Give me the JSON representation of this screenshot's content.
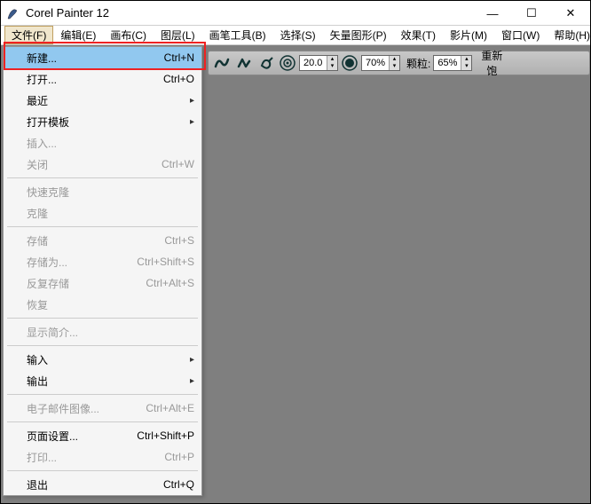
{
  "title": "Corel Painter 12",
  "window_controls": {
    "min": "—",
    "max": "☐",
    "close": "✕"
  },
  "menubar": [
    {
      "label": "文件(F)",
      "active": true
    },
    {
      "label": "编辑(E)"
    },
    {
      "label": "画布(C)"
    },
    {
      "label": "图层(L)"
    },
    {
      "label": "画笔工具(B)"
    },
    {
      "label": "选择(S)"
    },
    {
      "label": "矢量图形(P)"
    },
    {
      "label": "效果(T)"
    },
    {
      "label": "影片(M)"
    },
    {
      "label": "窗口(W)"
    },
    {
      "label": "帮助(H)"
    }
  ],
  "dropdown": [
    {
      "type": "item",
      "label": "新建...",
      "shortcut": "Ctrl+N",
      "highlighted": true
    },
    {
      "type": "item",
      "label": "打开...",
      "shortcut": "Ctrl+O"
    },
    {
      "type": "item",
      "label": "最近",
      "submenu": true
    },
    {
      "type": "item",
      "label": "打开模板",
      "submenu": true
    },
    {
      "type": "item",
      "label": "插入...",
      "disabled": true
    },
    {
      "type": "item",
      "label": "关闭",
      "shortcut": "Ctrl+W",
      "disabled": true
    },
    {
      "type": "sep"
    },
    {
      "type": "item",
      "label": "快速克隆",
      "disabled": true
    },
    {
      "type": "item",
      "label": "克隆",
      "disabled": true
    },
    {
      "type": "sep"
    },
    {
      "type": "item",
      "label": "存储",
      "shortcut": "Ctrl+S",
      "disabled": true
    },
    {
      "type": "item",
      "label": "存储为...",
      "shortcut": "Ctrl+Shift+S",
      "disabled": true
    },
    {
      "type": "item",
      "label": "反复存储",
      "shortcut": "Ctrl+Alt+S",
      "disabled": true
    },
    {
      "type": "item",
      "label": "恢复",
      "disabled": true
    },
    {
      "type": "sep"
    },
    {
      "type": "item",
      "label": "显示简介...",
      "disabled": true
    },
    {
      "type": "sep"
    },
    {
      "type": "item",
      "label": "输入",
      "submenu": true
    },
    {
      "type": "item",
      "label": "输出",
      "submenu": true
    },
    {
      "type": "sep"
    },
    {
      "type": "item",
      "label": "电子邮件图像...",
      "shortcut": "Ctrl+Alt+E",
      "disabled": true
    },
    {
      "type": "sep"
    },
    {
      "type": "item",
      "label": "页面设置...",
      "shortcut": "Ctrl+Shift+P"
    },
    {
      "type": "item",
      "label": "打印...",
      "shortcut": "Ctrl+P",
      "disabled": true
    },
    {
      "type": "sep"
    },
    {
      "type": "item",
      "label": "退出",
      "shortcut": "Ctrl+Q"
    }
  ],
  "toolbar": {
    "size_value": "20.0",
    "opacity_value": "70%",
    "grain_label": "颗粒:",
    "grain_value": "65%",
    "resat_label": "重新饱"
  }
}
